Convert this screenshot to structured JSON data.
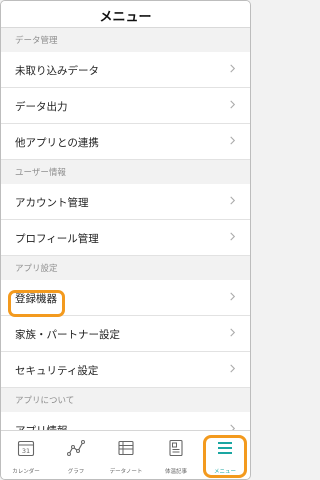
{
  "header": {
    "title": "メニュー"
  },
  "sections": [
    {
      "title": "データ管理",
      "items": [
        "未取り込みデータ",
        "データ出力",
        "他アプリとの連携"
      ]
    },
    {
      "title": "ユーザー情報",
      "items": [
        "アカウント管理",
        "プロフィール管理"
      ]
    },
    {
      "title": "アプリ設定",
      "items": [
        "登録機器",
        "家族・パートナー設定",
        "セキュリティ設定"
      ]
    },
    {
      "title": "アプリについて",
      "items": [
        "アプリ情報"
      ]
    }
  ],
  "tabbar": {
    "calendar_day": "31",
    "tabs": [
      {
        "label": "カレンダー",
        "icon": "calendar-icon"
      },
      {
        "label": "グラフ",
        "icon": "graph-icon"
      },
      {
        "label": "データノート",
        "icon": "data-note-icon"
      },
      {
        "label": "体温記事",
        "icon": "article-icon"
      },
      {
        "label": "メニュー",
        "icon": "menu-icon",
        "active": true
      }
    ]
  },
  "colors": {
    "accent": "#1aa6a2",
    "highlight": "#f39a1e"
  }
}
